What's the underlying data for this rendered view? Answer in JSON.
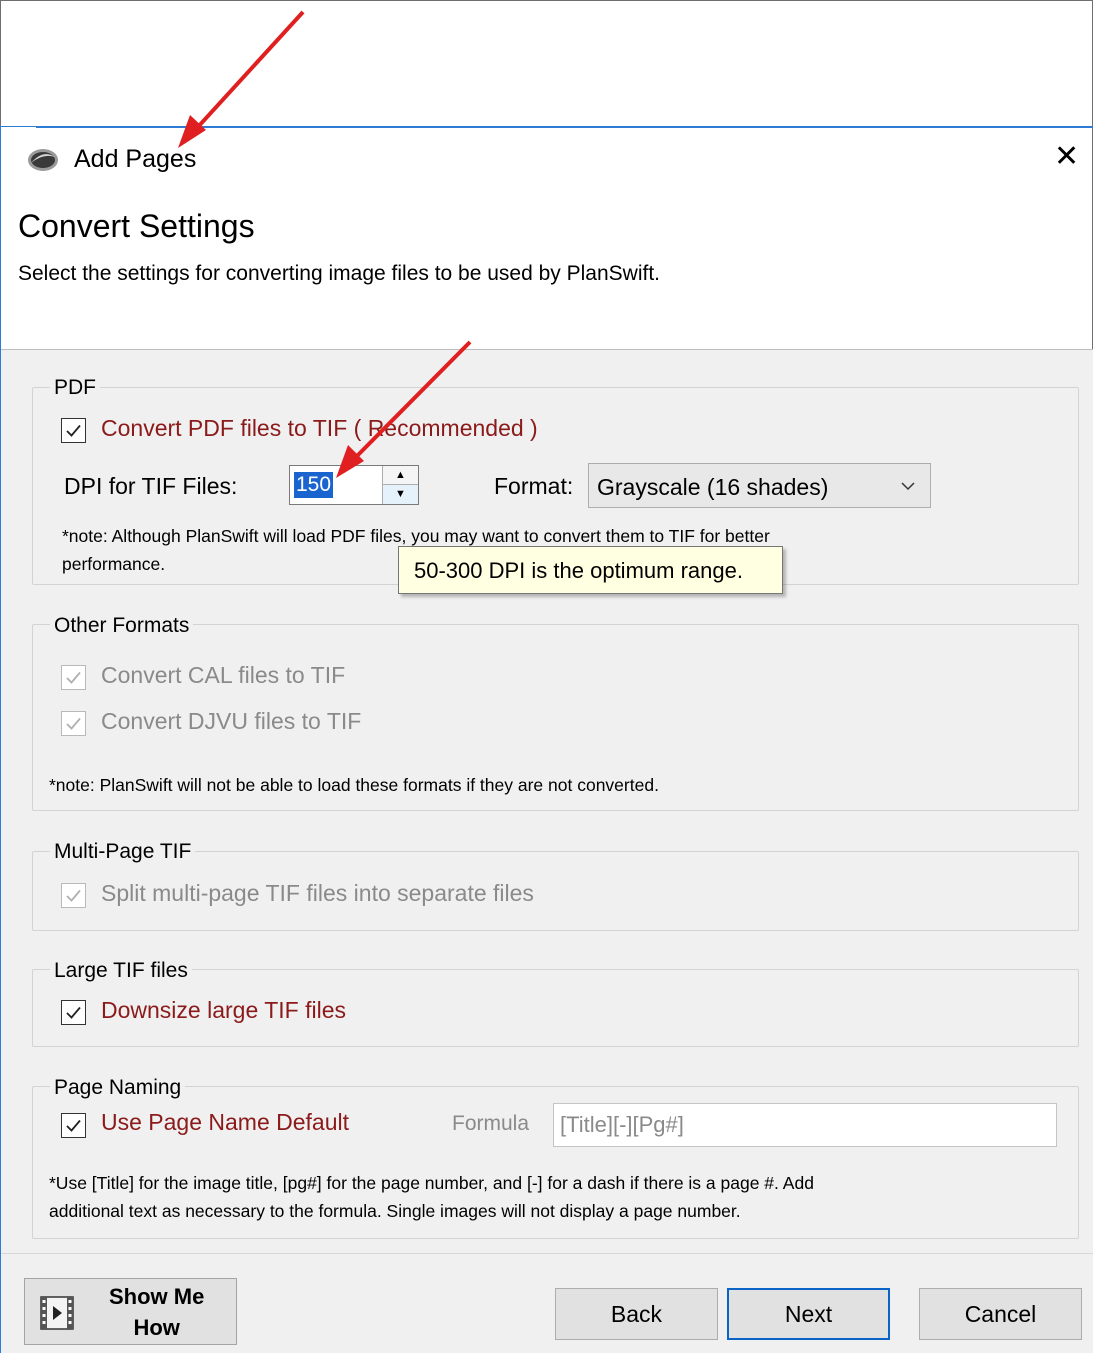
{
  "window": {
    "title": "Add Pages",
    "app_icon": "planswift-logo-icon",
    "close_glyph": "✕"
  },
  "header": {
    "heading": "Convert Settings",
    "subheading": "Select the settings for converting image files to be used by PlanSwift."
  },
  "pdf_group": {
    "title": "PDF",
    "convert_checkbox": {
      "label": "Convert PDF files to TIF  ( Recommended )",
      "checked": true
    },
    "dpi_label": "DPI for TIF Files:",
    "dpi_value": "150",
    "format_label": "Format:",
    "format_value": "Grayscale (16 shades)",
    "note_line1": "*note:  Although PlanSwift will load PDF files, you may want to convert them to TIF for better",
    "note_line2": "performance."
  },
  "tooltip": {
    "text": "50-300 DPI is the optimum range."
  },
  "other_group": {
    "title": "Other Formats",
    "cal_checkbox": {
      "label": "Convert CAL files to TIF",
      "checked": true,
      "disabled": true
    },
    "djvu_checkbox": {
      "label": "Convert DJVU files to TIF",
      "checked": true,
      "disabled": true
    },
    "note": "*note: PlanSwift will not be able to load these formats if they are not converted."
  },
  "multipage_group": {
    "title": "Multi-Page TIF",
    "split_checkbox": {
      "label": "Split multi-page TIF files into separate files",
      "checked": true,
      "disabled": true
    }
  },
  "large_group": {
    "title": "Large TIF files",
    "downsize_checkbox": {
      "label": "Downsize large TIF files",
      "checked": true
    }
  },
  "naming_group": {
    "title": "Page Naming",
    "default_checkbox": {
      "label": "Use Page Name Default",
      "checked": true
    },
    "formula_label": "Formula",
    "formula_value": "[Title][-][Pg#]",
    "note_line1": "*Use [Title] for the image title, [pg#] for the page number, and [-] for a dash if there is a page #.  Add",
    "note_line2": "additional text as necessary to the formula.  Single images will not display a page number."
  },
  "footer": {
    "show_me_line1": "Show Me",
    "show_me_line2": "How",
    "back": "Back",
    "next": "Next",
    "cancel": "Cancel"
  },
  "colors": {
    "accent": "#2e7bd6",
    "checkbox_label_red": "#8b1a1a",
    "annotation_arrow": "#e02020",
    "tooltip_bg": "#ffffe1"
  }
}
